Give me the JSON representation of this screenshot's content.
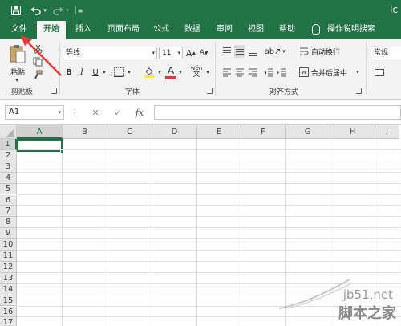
{
  "brand": "Ic",
  "tabs": [
    {
      "label": "文件",
      "active": false
    },
    {
      "label": "开始",
      "active": true
    },
    {
      "label": "插入",
      "active": false
    },
    {
      "label": "页面布局",
      "active": false
    },
    {
      "label": "公式",
      "active": false
    },
    {
      "label": "数据",
      "active": false
    },
    {
      "label": "审阅",
      "active": false
    },
    {
      "label": "视图",
      "active": false
    },
    {
      "label": "帮助",
      "active": false
    },
    {
      "label": "操作说明搜索",
      "active": false
    }
  ],
  "ribbon": {
    "clipboard": {
      "paste_label": "粘贴",
      "group_label": "剪贴板"
    },
    "font": {
      "group_label": "字体",
      "font_name": "等线",
      "font_size": "11",
      "grow_label": "A",
      "shrink_label": "A",
      "bold": "B",
      "italic": "I",
      "underline": "U",
      "font_color_label": "A",
      "wen_label": "wén"
    },
    "alignment": {
      "group_label": "对齐方式",
      "wrap_label": "自动换行",
      "merge_label": "合并后居中"
    },
    "number": {
      "format": "常规"
    }
  },
  "formula_bar": {
    "name_box": "A1",
    "cancel": "✕",
    "enter": "✓",
    "fx": "fx",
    "value": ""
  },
  "grid": {
    "columns": [
      "A",
      "B",
      "C",
      "D",
      "E",
      "F",
      "G",
      "H",
      "I"
    ],
    "rows": [
      "1",
      "2",
      "3",
      "4",
      "5",
      "6",
      "7",
      "8",
      "9",
      "10",
      "11",
      "12",
      "13",
      "14",
      "15",
      "16",
      "17"
    ],
    "selected_cell": "A1"
  },
  "watermark": {
    "url": "jb51.net",
    "name": "脚本之家"
  },
  "colors": {
    "accent": "#217346",
    "arrow": "#e53935"
  }
}
